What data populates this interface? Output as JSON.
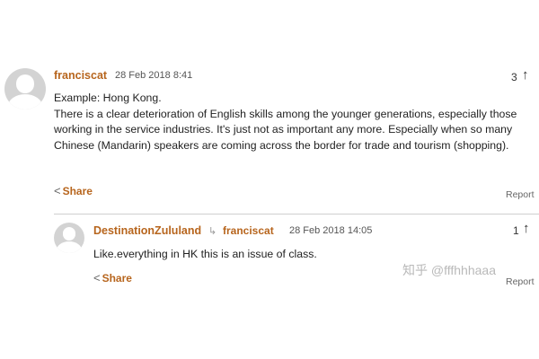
{
  "comment1": {
    "author": "franciscat",
    "timestamp": "28 Feb 2018 8:41",
    "recommend_count": "3",
    "paragraphs": [
      "Example: Hong Kong.",
      "There is a clear deterioration of English skills among the younger generations, especially those working in the service industries. It's just not as important any more. Especially when so many Chinese (Mandarin) speakers are coming across the border for trade and tourism (shopping)."
    ],
    "share_label": "Share",
    "report_label": "Report"
  },
  "comment2": {
    "author": "DestinationZululand",
    "reply_to": "franciscat",
    "timestamp": "28 Feb 2018 14:05",
    "recommend_count": "1",
    "text": "Like.everything in HK this is an issue of class.",
    "share_label": "Share",
    "report_label": "Report"
  },
  "icons": {
    "share": "share-icon",
    "recommend": "up-arrow-icon",
    "reply": "reply-arrow-icon"
  },
  "watermark": "知乎 @fffhhhaaa"
}
